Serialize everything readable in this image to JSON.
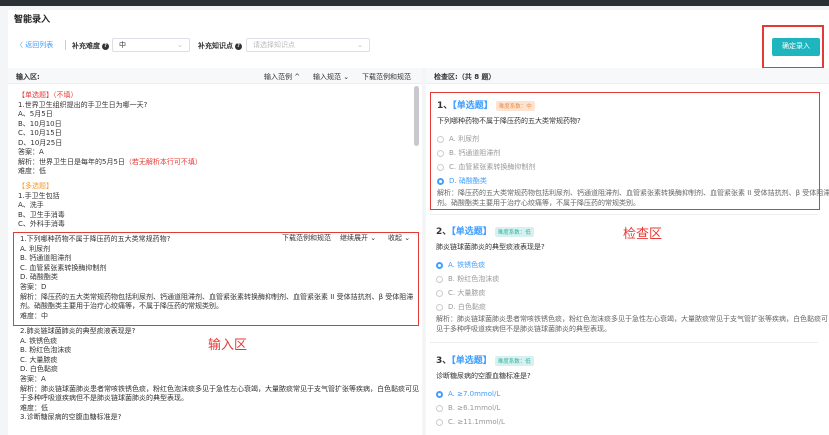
{
  "app": {
    "title": "智能录入",
    "back": "〈 返回列表",
    "difficulty_label": "补充难度",
    "difficulty_value": "中",
    "knowledge_label": "补充知识点",
    "knowledge_placeholder": "请选择知识点",
    "confirm_button": "确定录入",
    "help_glyph": "?"
  },
  "input_panel": {
    "title": "输入区:",
    "links": [
      "输入范例 ^",
      "输入规范 ⌄",
      "下载范例和规范"
    ],
    "zone_label": "输入区",
    "block1": [
      {
        "text": "【单选题】（不填）",
        "style": "red"
      },
      {
        "text": "1.世界卫生组织提出的手卫生日为哪一天?"
      },
      {
        "text": "A、5月5日"
      },
      {
        "text": "B、10月10日"
      },
      {
        "text": "C、10月15日"
      },
      {
        "text": "D、10月25日"
      },
      {
        "text": "答案：A"
      },
      {
        "text": "解析：世界卫生日是每年的5月5日（若无解析本行可不填）",
        "red_suffix": true
      },
      {
        "text": "难度：低"
      }
    ],
    "block2": [
      {
        "text": "【多选题】",
        "style": "orange"
      },
      {
        "text": "1.手卫生包括"
      },
      {
        "text": "A、洗手"
      },
      {
        "text": "B、卫生手消毒"
      },
      {
        "text": "C、外科手消毒"
      }
    ],
    "edit_toolbar": [
      "下载范例和规范",
      "继续展开 ⌄",
      "收起 ⌄"
    ],
    "edit_block": [
      "1.下列哪种药物不属于降压药的五大类常规药物?",
      "A. 利尿剂",
      "B. 钙通道阻滞剂",
      "C. 血管紧张素转换酶抑制剂",
      "D. 硝酸酯类",
      "答案：D",
      "解析：降压药的五大类常规药物包括利尿剂、钙通道阻滞剂、血管紧张素转换酶抑制剂、血管紧张素 II 受体拮抗剂、β 受体阻滞",
      "剂。硝酸酯类主要用于治疗心绞痛等，不属于降压药的常规类别。",
      "难度：中"
    ],
    "block3": [
      "2.肺炎链球菌肺炎的典型痰液表现是?",
      "A. 铁锈色痰",
      "B. 粉红色泡沫痰",
      "C. 大量脓痰",
      "D. 白色黏痰",
      "答案：A",
      "解析：肺炎链球菌肺炎患者常咳铁锈色痰，粉红色泡沫痰多见于急性左心衰竭，大量脓痰常见于支气管扩张等疾病，白色黏痰可见",
      "于多种呼吸道疾病但不是肺炎链球菌肺炎的典型表现。",
      "难度：低",
      "3.诊断糖尿病的空腹血糖标准是?"
    ]
  },
  "check_panel": {
    "title": "检查区:（共 8 题）",
    "zone_label": "检查区",
    "questions": [
      {
        "num": "1、",
        "type": "【单选题】",
        "difficulty": "难度系数：中",
        "stem": "下列哪种药物不属于降压药的五大类常规药物?",
        "options": [
          "A. 利尿剂",
          "B. 钙通道阻滞剂",
          "C. 血管紧张素转换酶抑制剂",
          "D. 硝酸酯类"
        ],
        "selected": 3,
        "analysis": [
          "解析：降压药的五大类常规药物包括利尿剂、钙通道阻滞剂、血管紧张素转换酶抑制剂、血管紧张素 II 受体拮抗剂、β 受体阻滞",
          "剂。硝酸酯类主要用于治疗心绞痛等，不属于降压药的常规类别。"
        ]
      },
      {
        "num": "2、",
        "type": "【单选题】",
        "difficulty": "难度系数：低",
        "stem": "肺炎链球菌肺炎的典型痰液表现是?",
        "options": [
          "A. 铁锈色痰",
          "B. 粉红色泡沫痰",
          "C. 大量脓痰",
          "D. 白色黏痰"
        ],
        "selected": 0,
        "analysis": [
          "解析：肺炎链球菌肺炎患者常咳铁锈色痰，粉红色泡沫痰多见于急性左心衰竭，大量脓痰常见于支气管扩张等疾病，白色黏痰可",
          "见于多种呼吸道疾病但不是肺炎链球菌肺炎的典型表现。"
        ]
      },
      {
        "num": "3、",
        "type": "【单选题】",
        "difficulty": "难度系数：低",
        "stem": "诊断糖尿病的空腹血糖标准是?",
        "options": [
          "A. ≥7.0mmol/L",
          "B. ≥6.1mmol/L",
          "C. ≥11.1mmol/L"
        ],
        "selected": 0,
        "analysis": []
      }
    ]
  },
  "colors": {
    "accent": "#409eff",
    "highlight": "#e53935",
    "confirm": "#1fb5be"
  }
}
